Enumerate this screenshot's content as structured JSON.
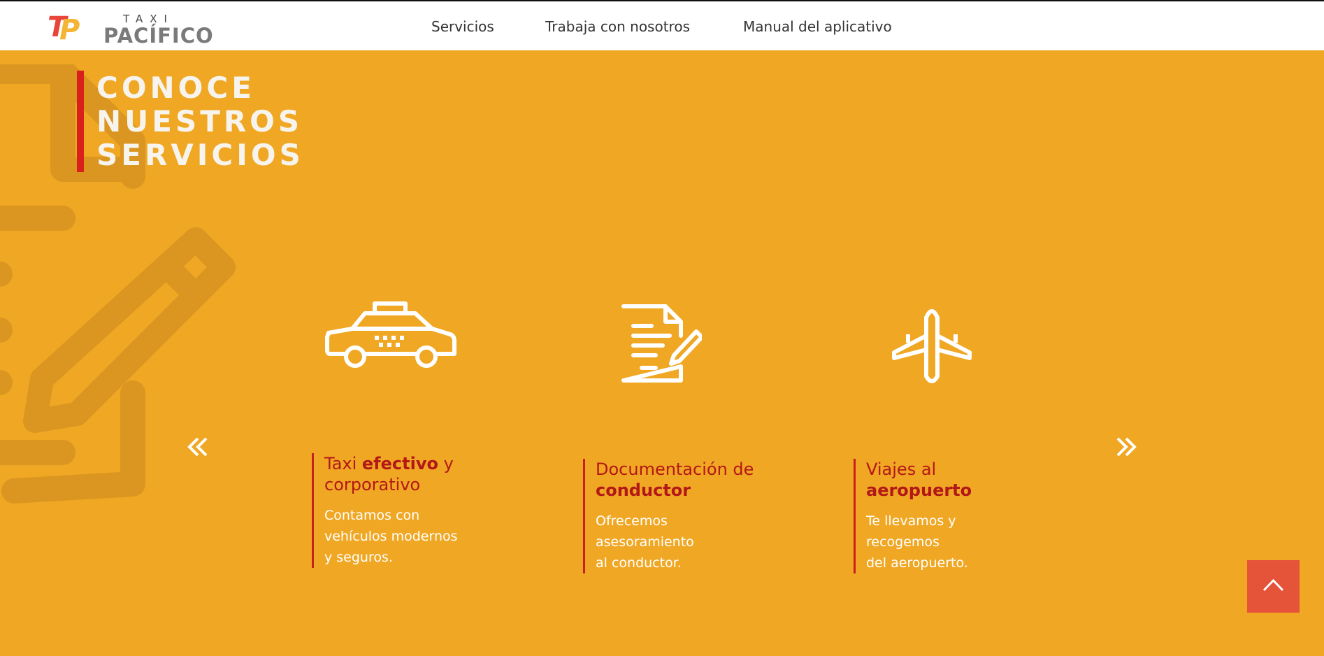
{
  "brand": {
    "top": "TAXI",
    "name": "PACÍFICO",
    "mark_t": "T",
    "mark_p": "P"
  },
  "nav": {
    "items": [
      {
        "label": "Servicios"
      },
      {
        "label": "Trabaja con nosotros"
      },
      {
        "label": "Manual del aplicativo"
      }
    ]
  },
  "hero": {
    "title_lines": [
      "CONOCE",
      "NUESTROS",
      "SERVICIOS"
    ]
  },
  "services": [
    {
      "icon": "taxi-car-icon",
      "heading_pre": "Taxi ",
      "heading_bold": "efectivo",
      "heading_post": " y corporativo",
      "desc_lines": [
        "Contamos con",
        "vehículos modernos",
        "y seguros."
      ]
    },
    {
      "icon": "document-pen-icon",
      "heading_pre": "Documentación de ",
      "heading_bold": "conductor",
      "heading_post": "",
      "desc_lines": [
        "Ofrecemos",
        "asesoramiento",
        "al conductor."
      ]
    },
    {
      "icon": "airplane-icon",
      "heading_pre": "Viajes al ",
      "heading_bold": "aeropuerto",
      "heading_post": "",
      "desc_lines": [
        "Te llevamos y",
        "recogemos",
        "del aeropuerto."
      ]
    }
  ],
  "controls": {
    "prev": "double-chevron-left-icon",
    "next": "double-chevron-right-icon",
    "scroll_top": "chevron-up-icon"
  },
  "colors": {
    "accent_bg": "#f0a723",
    "title_bar": "#d8211b",
    "heading": "#b31818",
    "scroll_btn": "#e55339"
  }
}
